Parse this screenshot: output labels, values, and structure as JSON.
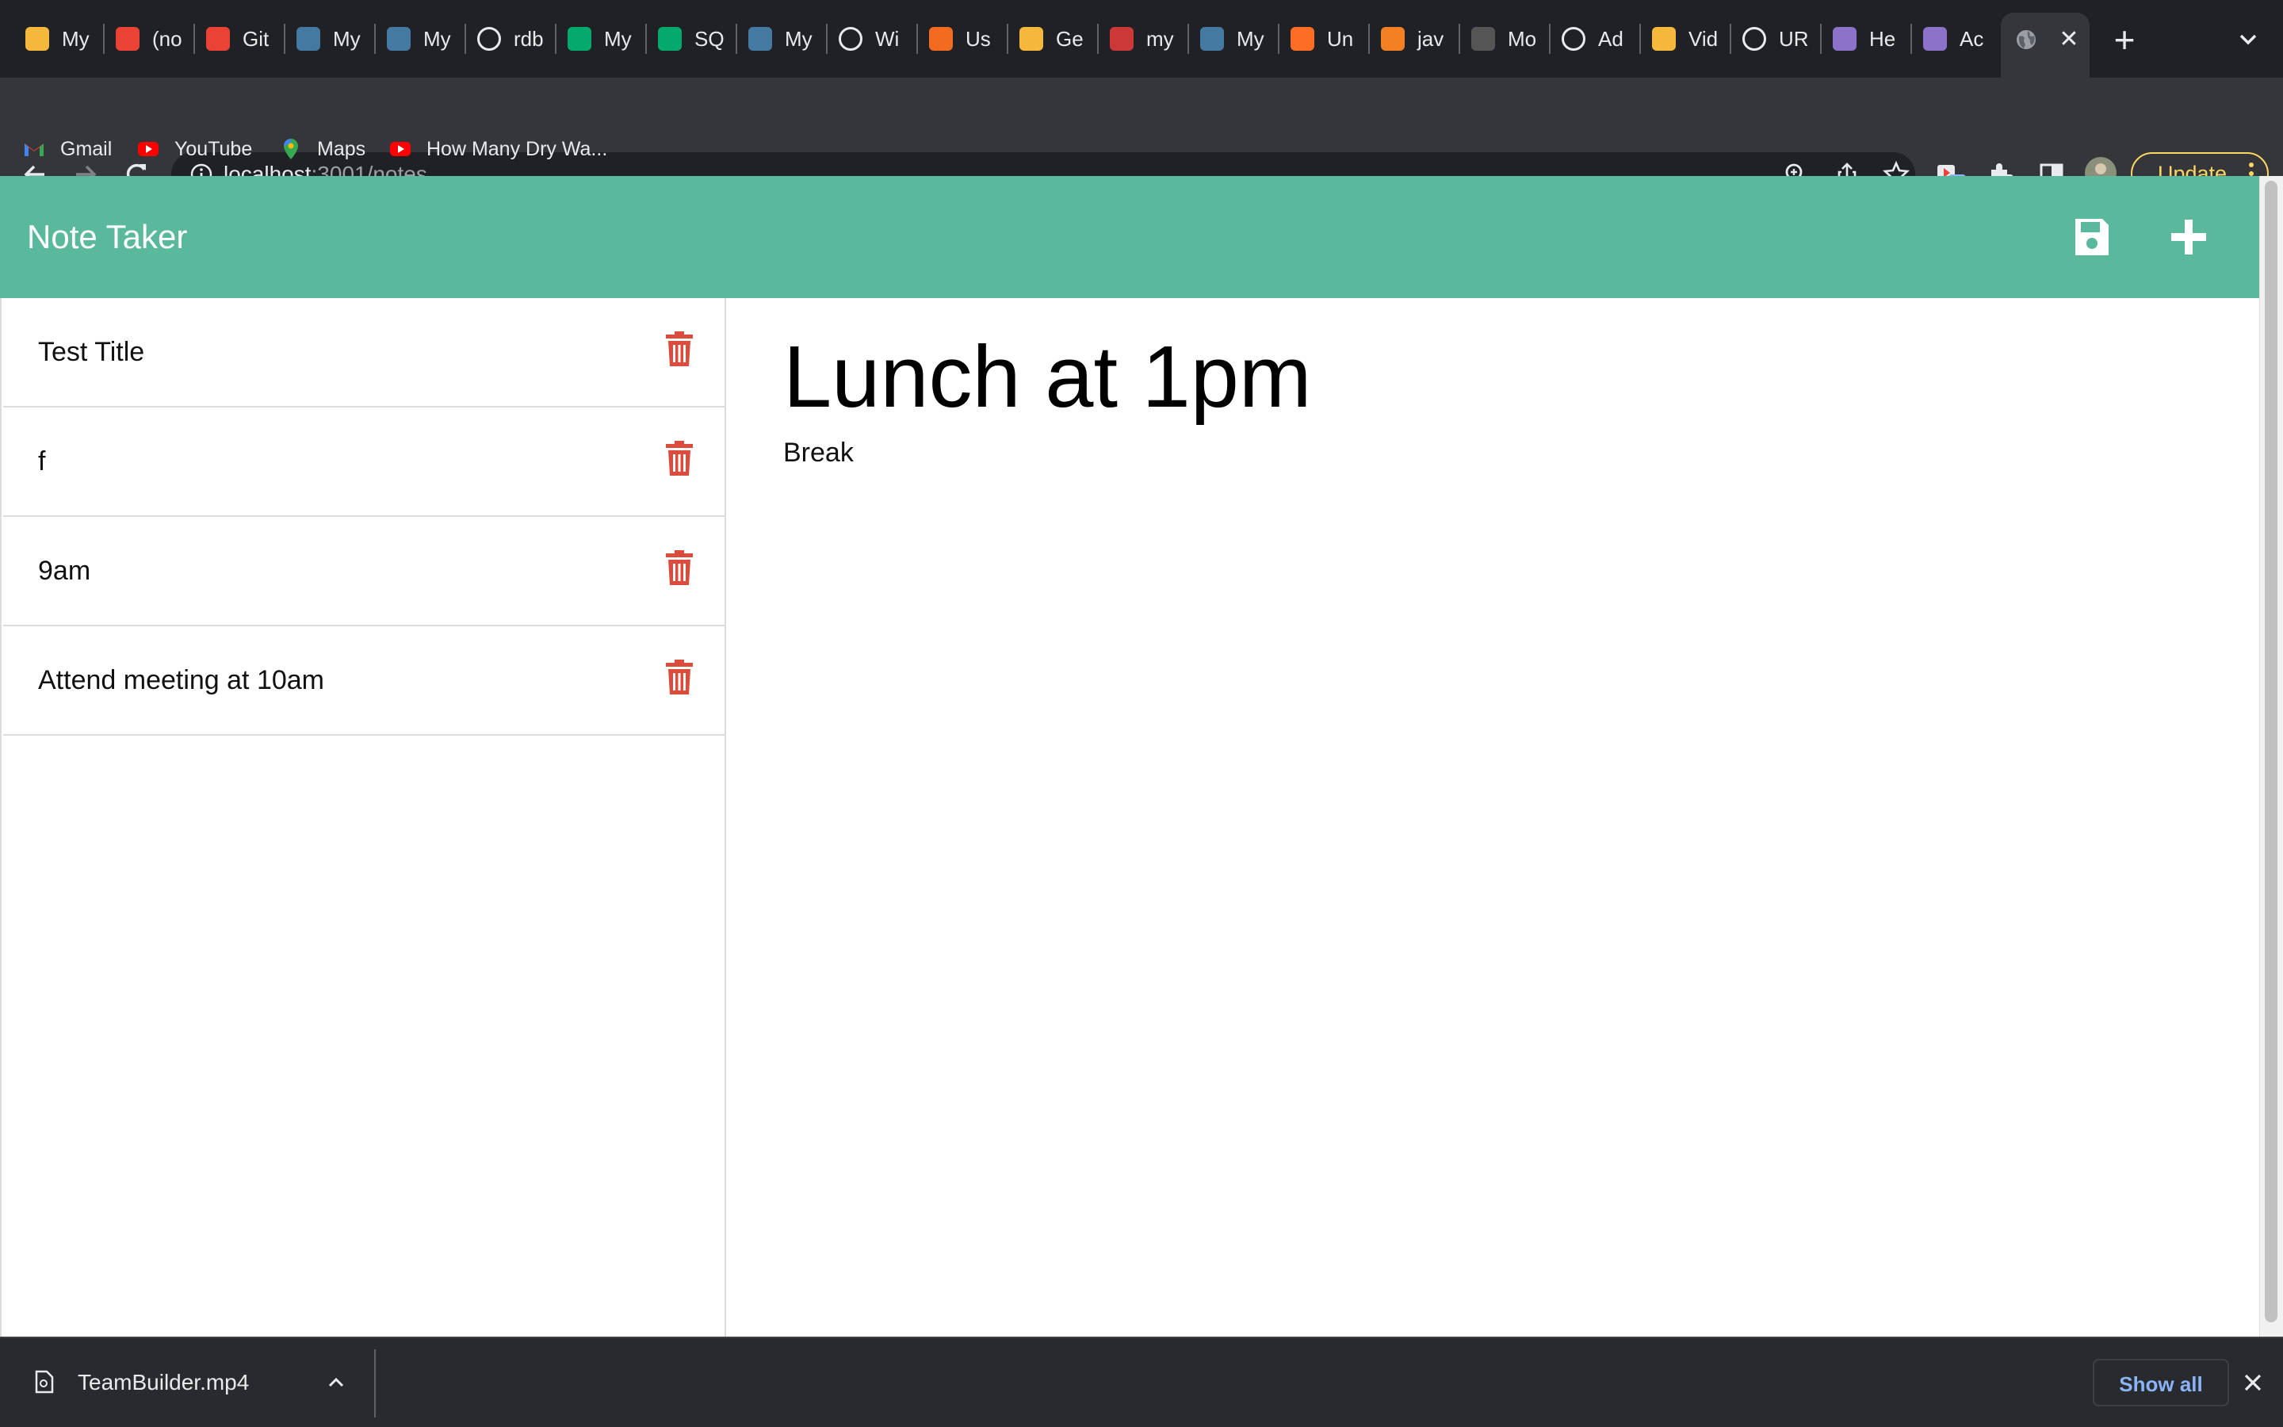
{
  "browser": {
    "tabs": [
      {
        "title": "My",
        "favicon": "fs-icon",
        "color": "#f6b83c"
      },
      {
        "title": "(no",
        "favicon": "gmail-icon",
        "color": "#ea4335"
      },
      {
        "title": "Git",
        "favicon": "gmail-icon",
        "color": "#ea4335"
      },
      {
        "title": "My",
        "favicon": "mysql-icon",
        "color": "#4479a1"
      },
      {
        "title": "My",
        "favicon": "mysql-icon",
        "color": "#4479a1"
      },
      {
        "title": "rdb",
        "favicon": "google-icon",
        "color": "#ffffff"
      },
      {
        "title": "My",
        "favicon": "w3schools-icon",
        "color": "#04aa6d"
      },
      {
        "title": "SQ",
        "favicon": "w3schools-icon",
        "color": "#04aa6d"
      },
      {
        "title": "My",
        "favicon": "mysql-icon",
        "color": "#4479a1"
      },
      {
        "title": "Wi",
        "favicon": "github-icon",
        "color": "#ffffff"
      },
      {
        "title": "Us",
        "favicon": "shield-icon",
        "color": "#f26b21"
      },
      {
        "title": "Ge",
        "favicon": "fs-icon",
        "color": "#f6b83c"
      },
      {
        "title": "my",
        "favicon": "npm-icon",
        "color": "#cb3837"
      },
      {
        "title": "My",
        "favicon": "mysql-icon",
        "color": "#4479a1"
      },
      {
        "title": "Un",
        "favicon": "gitlab-icon",
        "color": "#fc6d26"
      },
      {
        "title": "jav",
        "favicon": "stackoverflow-icon",
        "color": "#f48024"
      },
      {
        "title": "Mo",
        "favicon": "dark-square-icon",
        "color": "#555555"
      },
      {
        "title": "Ad",
        "favicon": "github-icon",
        "color": "#ffffff"
      },
      {
        "title": "Vid",
        "favicon": "fs-icon",
        "color": "#f6b83c"
      },
      {
        "title": "UR",
        "favicon": "mdn-icon",
        "color": "#ffffff"
      },
      {
        "title": "He",
        "favicon": "heroku-icon",
        "color": "#8c72c8"
      },
      {
        "title": "Ac",
        "favicon": "heroku-icon",
        "color": "#8c72c8"
      }
    ],
    "url_host": "localhost",
    "url_path": ":3001/notes",
    "update_label": "Update",
    "extension_badge": "1",
    "bookmarks": [
      {
        "label": "Gmail",
        "icon": "gmail-icon"
      },
      {
        "label": "YouTube",
        "icon": "youtube-icon"
      },
      {
        "label": "Maps",
        "icon": "maps-icon"
      },
      {
        "label": "How Many Dry Wa...",
        "icon": "youtube-icon"
      }
    ]
  },
  "app": {
    "title": "Note Taker",
    "accent_color": "#5ab99d",
    "delete_color": "#dc4c3c",
    "notes": [
      {
        "title": "Test Title"
      },
      {
        "title": "f"
      },
      {
        "title": "9am"
      },
      {
        "title": "Attend meeting at 10am"
      }
    ],
    "active_note": {
      "title": "Lunch at 1pm",
      "text": "Break"
    }
  },
  "downloads": {
    "file_name": "TeamBuilder.mp4",
    "show_all_label": "Show all"
  }
}
